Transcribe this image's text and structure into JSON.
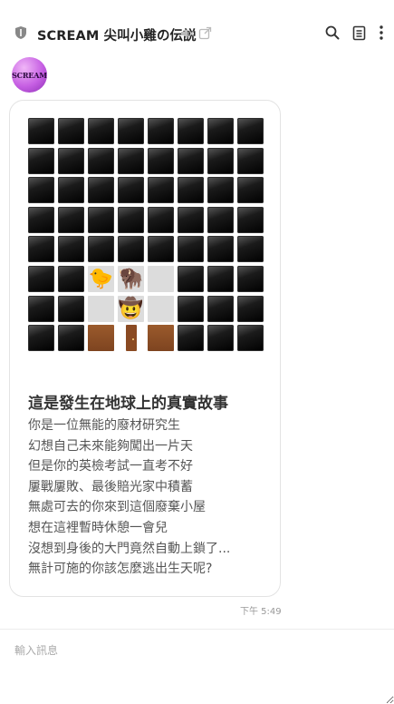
{
  "header": {
    "title": "SCREAM 尖叫小雞の伝説",
    "icons": [
      "shield-icon",
      "speaker-muted-icon",
      "external-link-icon",
      "search-icon",
      "notes-icon",
      "more-vertical-icon"
    ]
  },
  "avatar": {
    "text": "SCREAM"
  },
  "message": {
    "grid": {
      "cols": 8,
      "rows": 8,
      "cells": [
        "B",
        "B",
        "B",
        "B",
        "B",
        "B",
        "B",
        "B",
        "B",
        "B",
        "B",
        "B",
        "B",
        "B",
        "B",
        "B",
        "B",
        "B",
        "B",
        "B",
        "B",
        "B",
        "B",
        "B",
        "B",
        "B",
        "B",
        "B",
        "B",
        "B",
        "B",
        "B",
        "B",
        "B",
        "B",
        "B",
        "B",
        "B",
        "B",
        "B",
        "B",
        "B",
        "W",
        "W",
        "W",
        "B",
        "B",
        "B",
        "B",
        "B",
        "W",
        "W",
        "W",
        "B",
        "B",
        "B",
        "B",
        "B",
        "R",
        "D",
        "R",
        "B",
        "B",
        "B"
      ],
      "emojis": [
        {
          "char": "🐤",
          "name": "baby-chick-icon",
          "row": 5,
          "col": 2
        },
        {
          "char": "🦬",
          "name": "bison-icon",
          "row": 5,
          "col": 3
        },
        {
          "char": "🤠",
          "name": "cowboy-face-icon",
          "row": 6,
          "col": 3
        }
      ]
    },
    "title": "這是發生在地球上的真實故事",
    "lines": [
      "你是一位無能的廢材研究生",
      "幻想自己未來能夠闖出一片天",
      "但是你的英檢考試一直考不好",
      "屢戰屢敗、最後賠光家中積蓄",
      "無處可去的你來到這個廢棄小屋",
      "想在這裡暫時休憩一會兒",
      "沒想到身後的大門竟然自動上鎖了...",
      "無計可施的你該怎麼逃出生天呢?"
    ],
    "timestamp": "下午 5:49"
  },
  "composer": {
    "placeholder": "輸入訊息"
  }
}
